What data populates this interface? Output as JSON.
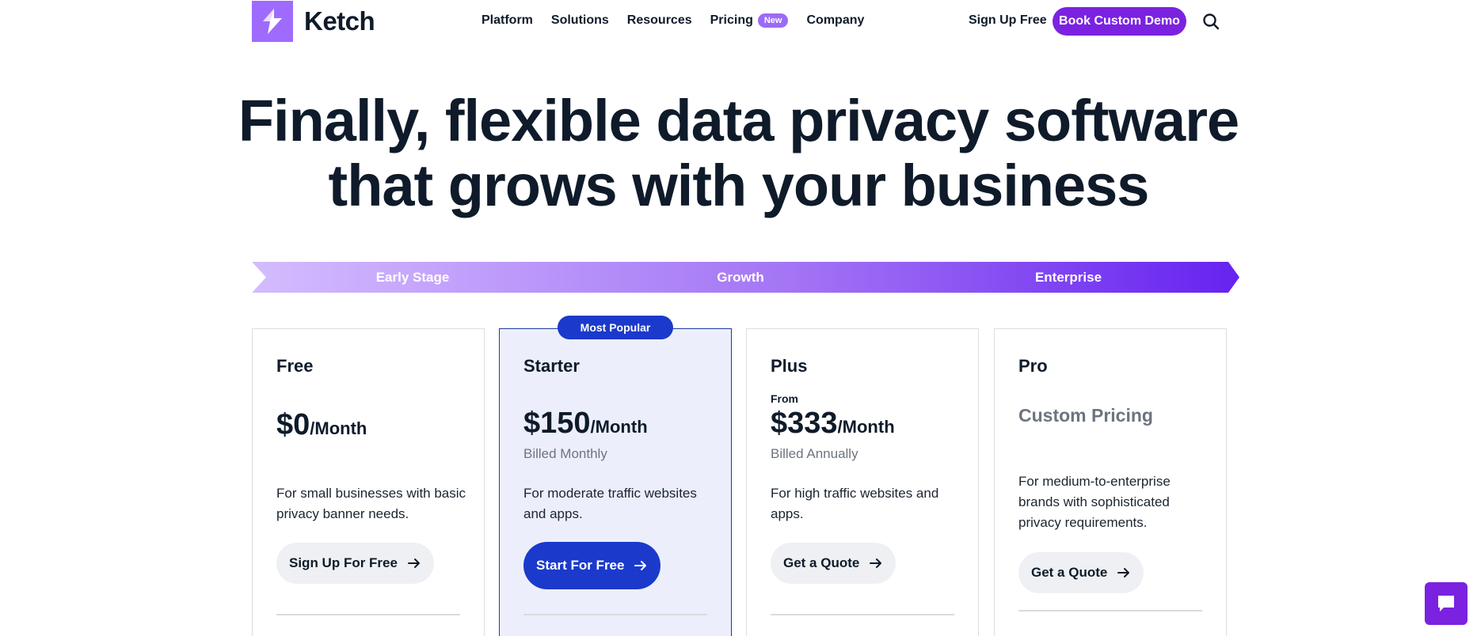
{
  "header": {
    "logo_text": "Ketch",
    "nav": [
      {
        "label": "Platform"
      },
      {
        "label": "Solutions"
      },
      {
        "label": "Resources"
      },
      {
        "label": "Pricing",
        "badge": "New"
      },
      {
        "label": "Company"
      }
    ],
    "signup_label": "Sign Up Free",
    "demo_label": "Book Custom Demo",
    "search_icon": "search-icon"
  },
  "hero": {
    "line1": "Finally, flexible data privacy software",
    "line2": "that grows with your business"
  },
  "stages": [
    "Early Stage",
    "Growth",
    "Enterprise"
  ],
  "plans": [
    {
      "name": "Free",
      "price": "$0",
      "per": "/Month",
      "description": "For small businesses with basic privacy banner needs.",
      "cta": "Sign Up For Free"
    },
    {
      "name": "Starter",
      "badge": "Most Popular",
      "price": "$150",
      "per": "/Month",
      "billed": "Billed Monthly",
      "description": "For moderate traffic websites and apps.",
      "cta": "Start For Free"
    },
    {
      "name": "Plus",
      "from": "From",
      "price": "$333",
      "per": "/Month",
      "billed": "Billed Annually",
      "description": "For high traffic websites and apps.",
      "cta": "Get a Quote"
    },
    {
      "name": "Pro",
      "custom_pricing": "Custom Pricing",
      "description": "For medium-to-enterprise brands with sophisticated privacy requirements.",
      "cta": "Get a Quote"
    }
  ],
  "colors": {
    "brand_purple": "#7b22e0",
    "logo_purple": "#9f6bff",
    "primary_blue": "#1b3acb",
    "popular_bg": "#eceffb",
    "text_dark": "#0f1b2a",
    "muted": "#6d7480"
  },
  "chat": {
    "icon": "chat-bubble-icon"
  }
}
